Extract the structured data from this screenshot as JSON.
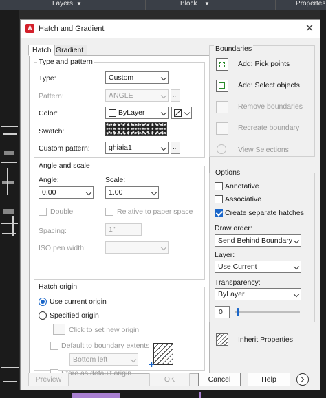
{
  "app_bar": {
    "layers": "Layers",
    "block": "Block",
    "properties": "Propertes"
  },
  "dialog": {
    "title": "Hatch and Gradient",
    "tabs": [
      {
        "label": "Hatch",
        "active": true
      },
      {
        "label": "Gradient",
        "active": false
      }
    ],
    "type_and_pattern": {
      "legend": "Type and pattern",
      "type_label": "Type:",
      "type_value": "Custom",
      "pattern_label": "Pattern:",
      "pattern_value": "ANGLE",
      "color_label": "Color:",
      "color_value": "ByLayer",
      "swatch_label": "Swatch:",
      "custom_pattern_label": "Custom pattern:",
      "custom_pattern_value": "ghiaia1",
      "more_button": "..."
    },
    "angle_and_scale": {
      "legend": "Angle and scale",
      "angle_label": "Angle:",
      "angle_value": "0.00",
      "scale_label": "Scale:",
      "scale_value": "1.00",
      "double_label": "Double",
      "double_checked": false,
      "relative_label": "Relative to paper space",
      "relative_checked": false,
      "spacing_label": "Spacing:",
      "spacing_value": "1\"",
      "iso_label": "ISO pen width:",
      "iso_value": ""
    },
    "hatch_origin": {
      "legend": "Hatch origin",
      "use_current": "Use current origin",
      "specified": "Specified origin",
      "click_to_set": "Click to set new origin",
      "default_extents": "Default to boundary extents",
      "extents_value": "Bottom left",
      "store_default": "Store as default origin"
    },
    "boundaries": {
      "title": "Boundaries",
      "add_pick": "Add: Pick points",
      "add_select": "Add: Select objects",
      "remove": "Remove boundaries",
      "recreate": "Recreate boundary",
      "view": "View Selections"
    },
    "options": {
      "title": "Options",
      "annotative": "Annotative",
      "annotative_checked": false,
      "associative": "Associative",
      "associative_checked": false,
      "separate": "Create separate hatches",
      "separate_checked": true,
      "draw_order_label": "Draw order:",
      "draw_order_value": "Send Behind Boundary",
      "layer_label": "Layer:",
      "layer_value": "Use Current",
      "transparency_label": "Transparency:",
      "transparency_value": "ByLayer",
      "transparency_number": "0"
    },
    "inherit": "Inherit Properties",
    "footer": {
      "preview": "Preview",
      "ok": "OK",
      "cancel": "Cancel",
      "help": "Help"
    }
  },
  "colors": {
    "accent": "#1a66c9",
    "brand": "#d31f2a"
  }
}
